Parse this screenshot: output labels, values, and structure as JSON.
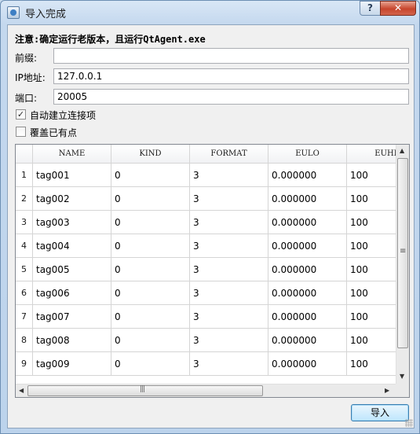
{
  "window": {
    "title": "导入完成",
    "help_label": "?",
    "close_label": "✕",
    "icon": "app-icon"
  },
  "form": {
    "notice": "注意:确定运行老版本，且运行QtAgent.exe",
    "prefix_label": "前缀:",
    "prefix_value": "",
    "ip_label": "IP地址:",
    "ip_value": "127.0.0.1",
    "port_label": "端口:",
    "port_value": "20005",
    "auto_connect_label": "自动建立连接项",
    "auto_connect_checked": true,
    "overwrite_label": "覆盖已有点",
    "overwrite_checked": false
  },
  "table": {
    "columns": [
      "NAME",
      "KIND",
      "FORMAT",
      "EULO",
      "EUHI"
    ],
    "rows": [
      {
        "index": "1",
        "cells": [
          "tag001",
          "0",
          "3",
          "0.000000",
          "100"
        ]
      },
      {
        "index": "2",
        "cells": [
          "tag002",
          "0",
          "3",
          "0.000000",
          "100"
        ]
      },
      {
        "index": "3",
        "cells": [
          "tag003",
          "0",
          "3",
          "0.000000",
          "100"
        ]
      },
      {
        "index": "4",
        "cells": [
          "tag004",
          "0",
          "3",
          "0.000000",
          "100"
        ]
      },
      {
        "index": "5",
        "cells": [
          "tag005",
          "0",
          "3",
          "0.000000",
          "100"
        ]
      },
      {
        "index": "6",
        "cells": [
          "tag006",
          "0",
          "3",
          "0.000000",
          "100"
        ]
      },
      {
        "index": "7",
        "cells": [
          "tag007",
          "0",
          "3",
          "0.000000",
          "100"
        ]
      },
      {
        "index": "8",
        "cells": [
          "tag008",
          "0",
          "3",
          "0.000000",
          "100"
        ]
      },
      {
        "index": "9",
        "cells": [
          "tag009",
          "0",
          "3",
          "0.000000",
          "100"
        ]
      }
    ]
  },
  "footer": {
    "import_label": "导入"
  }
}
